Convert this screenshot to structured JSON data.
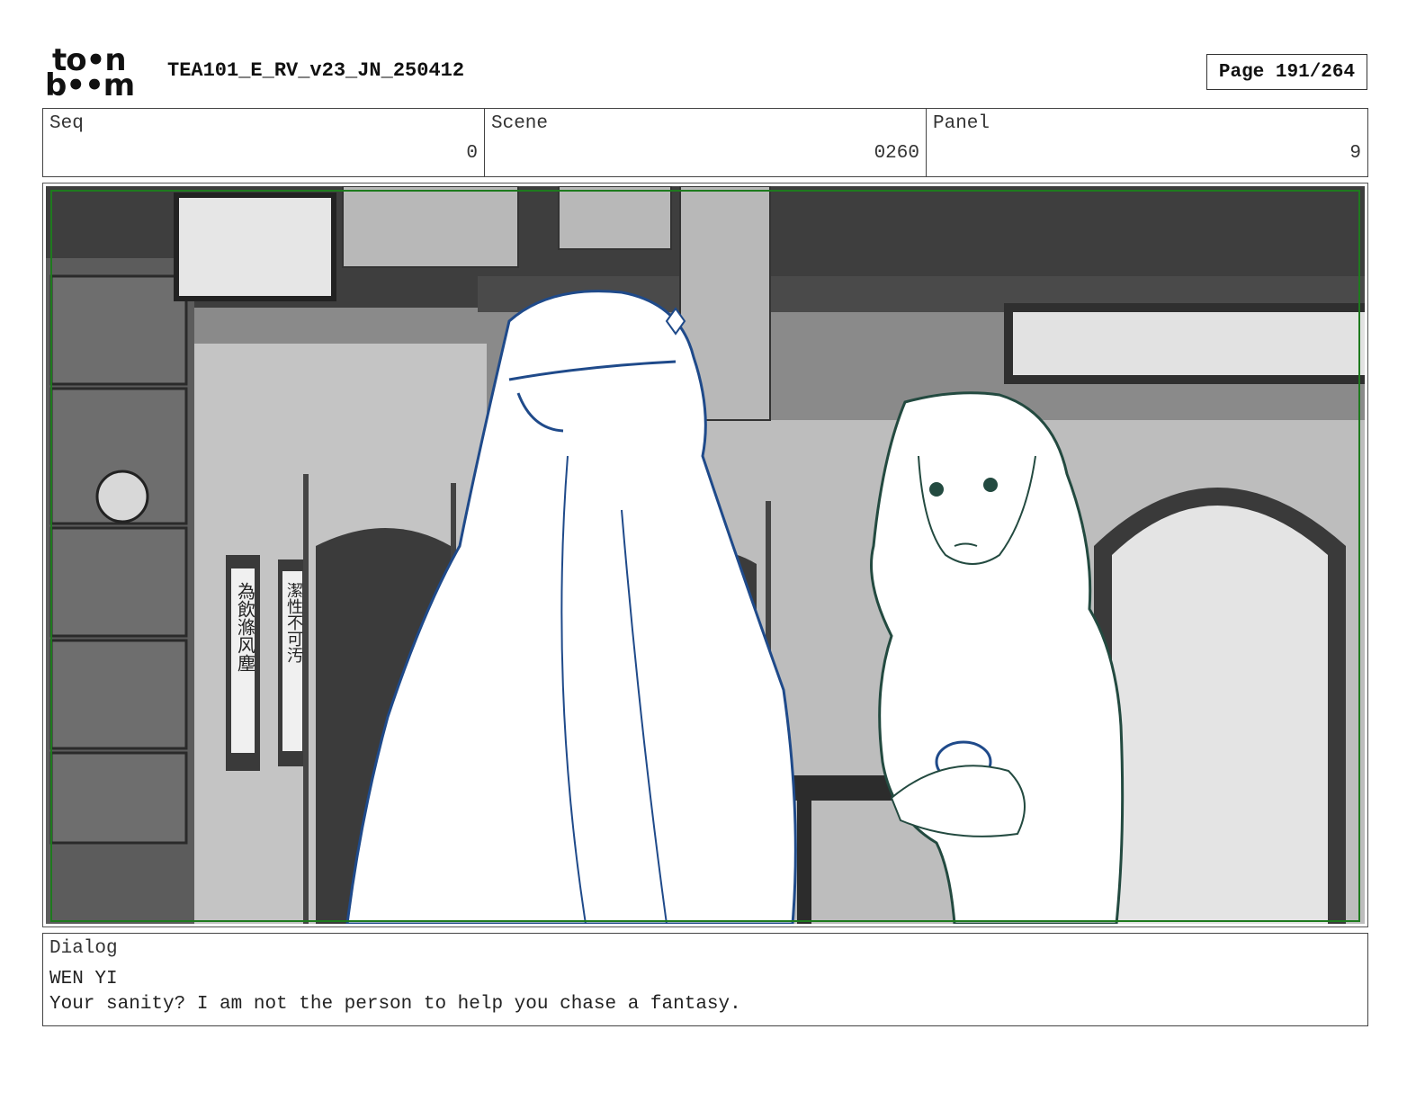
{
  "header": {
    "logo_top": "to•n",
    "logo_bottom": "b••m",
    "document_title": "TEA101_E_RV_v23_JN_250412",
    "page_label": "Page 191/264"
  },
  "info": {
    "seq_label": "Seq",
    "seq_value": "0",
    "scene_label": "Scene",
    "scene_value": "0260",
    "panel_label": "Panel",
    "panel_value": "9"
  },
  "panel_image": {
    "scroll_left_text": "為飲滌风塵",
    "scroll_right_text": "潔性不可汚"
  },
  "dialog": {
    "label": "Dialog",
    "speaker": "WEN YI",
    "line": "Your sanity? I am not the person to help you chase a fantasy."
  }
}
